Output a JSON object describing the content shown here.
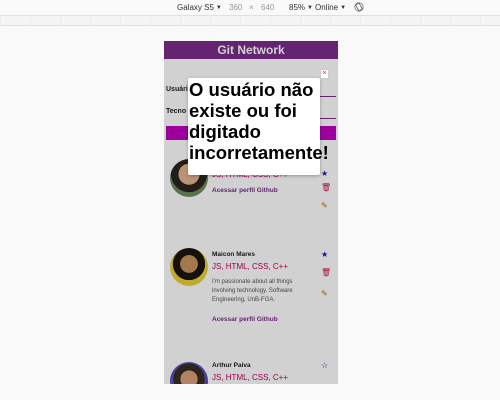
{
  "devtools": {
    "device": "Galaxy S5",
    "width": "360",
    "times": "×",
    "height": "640",
    "zoom": "85%",
    "network": "Online",
    "caret": "▼"
  },
  "app": {
    "title": "Git Network",
    "user_label": "Usuári",
    "tech_label": "Tecno"
  },
  "cards": [
    {
      "name": "",
      "skills": "JS, HTML, CSS, C++",
      "bio": "",
      "link": "Acessar perfil Github",
      "star": "★"
    },
    {
      "name": "Maicon Mares",
      "skills": "JS, HTML, CSS, C++",
      "bio": "I'm passionate about all things involving technology. Software Engineering, UnB-FGA.",
      "link": "Acessar perfil Github",
      "star": "★"
    },
    {
      "name": "Arthur Paiva",
      "skills": "JS, HTML, CSS, C++",
      "star": "☆"
    }
  ],
  "icons": {
    "trash": "🗑",
    "pencil": "✎"
  },
  "modal": {
    "message": "O usuário não existe ou foi digitado incorretamente!",
    "close": "×"
  }
}
